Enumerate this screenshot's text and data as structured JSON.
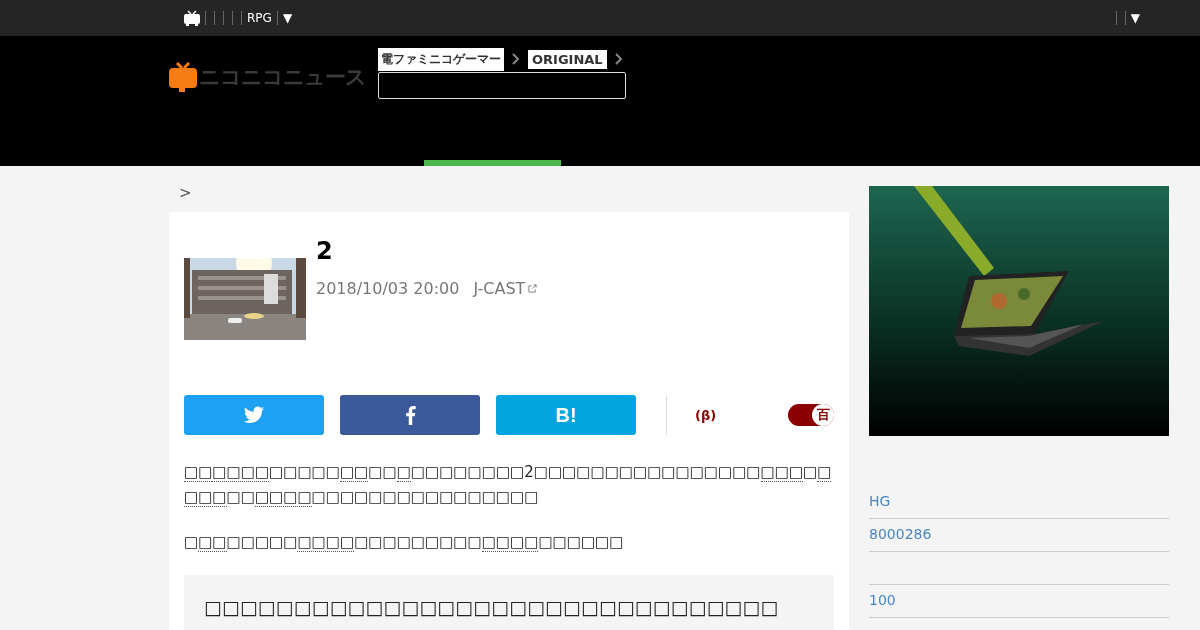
{
  "topbar": {
    "menu": [
      {
        "kind": "blank"
      },
      {
        "kind": "blank"
      },
      {
        "kind": "blank"
      },
      {
        "kind": "blank"
      },
      {
        "kind": "link",
        "label": "RPG"
      },
      {
        "kind": "link",
        "label": "▼"
      }
    ],
    "right_menu": [
      {
        "kind": "blank"
      },
      {
        "kind": "link",
        "label": "▼"
      }
    ]
  },
  "header": {
    "logo": "ニコニコニュース",
    "badges": [
      "電ファミニコゲーマー",
      "ORIGINAL"
    ]
  },
  "breadcrumb": ">",
  "article": {
    "title": "2",
    "date": "2018/10/03 20:00",
    "source": "J-CAST",
    "share_buttons": [
      {
        "kind": "twitter"
      },
      {
        "kind": "facebook"
      },
      {
        "kind": "hatena",
        "label": "B!"
      }
    ],
    "beta_label": "(β)",
    "toggle": {
      "on": true,
      "label": "百"
    },
    "paragraphs": [
      [
        {
          "text": "□□",
          "link": true
        },
        {
          "text": "□□□□",
          "link": true
        },
        {
          "text": "□□□□□",
          "link": false
        },
        {
          "text": "□□",
          "link": true
        },
        {
          "text": "□□",
          "link": false
        },
        {
          "text": "□",
          "link": true
        },
        {
          "text": "□□□□□□□□2□□□□□□□□□□□□□□□□",
          "link": false
        },
        {
          "text": "□□□",
          "link": true
        },
        {
          "text": "□",
          "link": false
        },
        {
          "text": "□□□□",
          "link": true
        },
        {
          "text": "□□",
          "link": false
        },
        {
          "text": "□□□□",
          "link": true
        },
        {
          "text": "□□□□□□□□□□□□□□□□",
          "link": false
        }
      ],
      [
        {
          "text": "□",
          "link": false
        },
        {
          "text": "□□",
          "link": true
        },
        {
          "text": "□□□□□",
          "link": false
        },
        {
          "text": "□□□□",
          "link": true
        },
        {
          "text": "□□□□□□□□□",
          "link": false
        },
        {
          "text": "□□□□",
          "link": true
        },
        {
          "text": "□□□□□□",
          "link": false
        }
      ]
    ],
    "box_heading": "□□□□□□□□□□□□□□□□□□□□□□□□□□□□□□□□"
  },
  "sidebar": {
    "links": [
      {
        "kind": "link",
        "label": "HG"
      },
      {
        "kind": "link",
        "label": "8000286"
      },
      {
        "kind": "blank"
      },
      {
        "kind": "link",
        "label": "100"
      }
    ]
  }
}
